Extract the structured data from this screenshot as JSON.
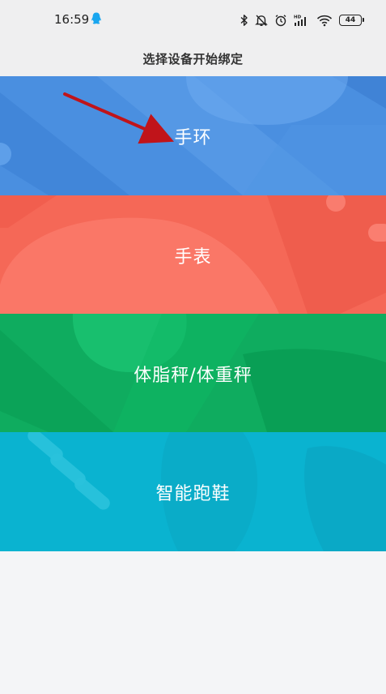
{
  "status_bar": {
    "time": "16:59",
    "battery_level": "44",
    "icons": [
      "qq-icon",
      "bluetooth-icon",
      "mute-icon",
      "alarm-icon",
      "hd-signal-icon",
      "wifi-icon",
      "battery-icon"
    ]
  },
  "header": {
    "title": "选择设备开始绑定"
  },
  "devices": [
    {
      "label": "手环",
      "color": "#4a8fe0"
    },
    {
      "label": "手表",
      "color": "#f56857"
    },
    {
      "label": "体脂秤/体重秤",
      "color": "#0fac5f"
    },
    {
      "label": "智能跑鞋",
      "color": "#0ab3d0"
    }
  ],
  "annotation": {
    "arrow_color": "#c0141a"
  }
}
